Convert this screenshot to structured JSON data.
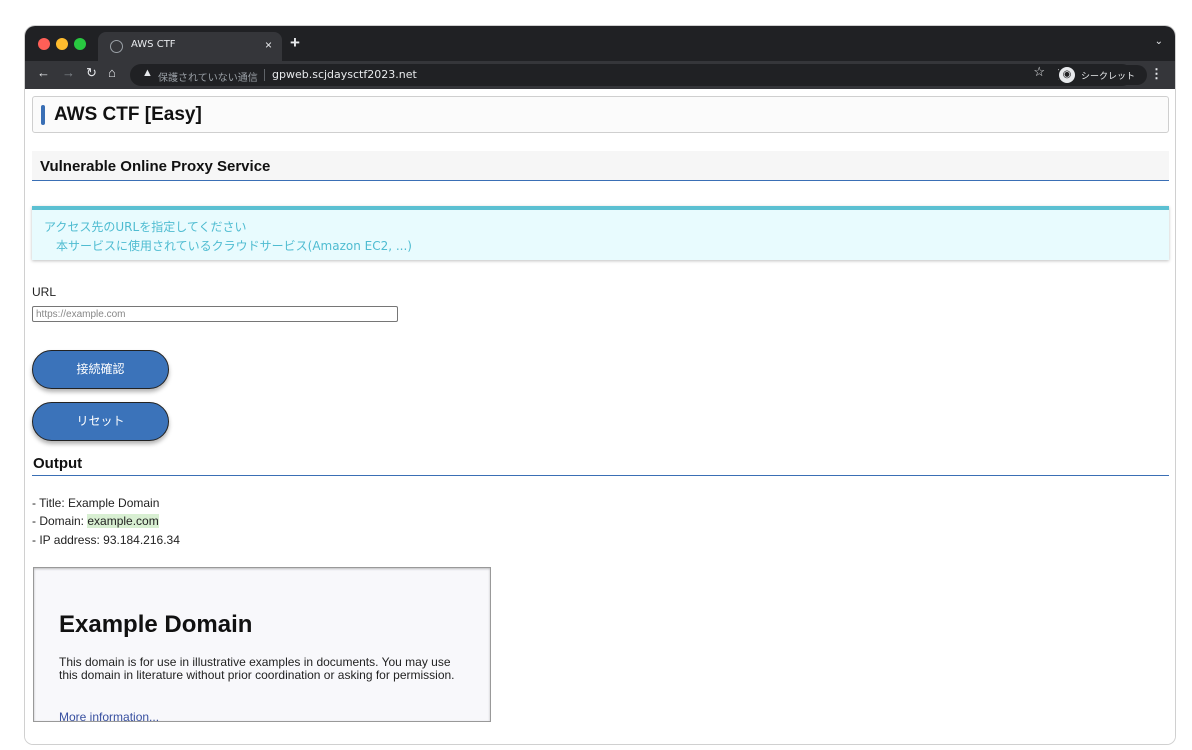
{
  "browser": {
    "tab_title": "AWS CTF",
    "tab_close": "×",
    "new_tab": "+",
    "tab_search": "⌄",
    "security_label": "保護されていない通信",
    "url": "gpweb.scjdaysctf2023.net",
    "incognito_label": "シークレット",
    "icons": [
      "back-icon",
      "forward-icon",
      "reload-icon",
      "home-icon",
      "warning-icon",
      "star-icon",
      "sidepanel-icon",
      "incognito-icon",
      "menu-icon"
    ]
  },
  "page": {
    "header_title": "AWS CTF [Easy]",
    "sub_title": "Vulnerable Online Proxy Service",
    "info_line1": "アクセス先のURLを指定してください",
    "info_line2": "本サービスに使用されているクラウドサービス(Amazon EC2, ...)",
    "url_label": "URL",
    "url_value": "",
    "url_placeholder": "https://example.com",
    "connect_button": "接続確認",
    "reset_button": "リセット",
    "output_title": "Output",
    "output": {
      "title_line": "- Title: Example Domain",
      "domain_prefix": "- Domain: ",
      "domain_value": "example.com",
      "ip_line": "- IP address: 93.184.216.34"
    },
    "frame": {
      "heading": "Example Domain",
      "paragraph": "This domain is for use in illustrative examples in documents. You may use this domain in literature without prior coordination or asking for permission.",
      "link": "More information..."
    }
  },
  "colors": {
    "accent": "#3a6fb5",
    "button": "#3b73ba",
    "info_text": "#4fbcd1",
    "info_bg": "#e8fbfe",
    "highlight": "#d8efd2"
  }
}
